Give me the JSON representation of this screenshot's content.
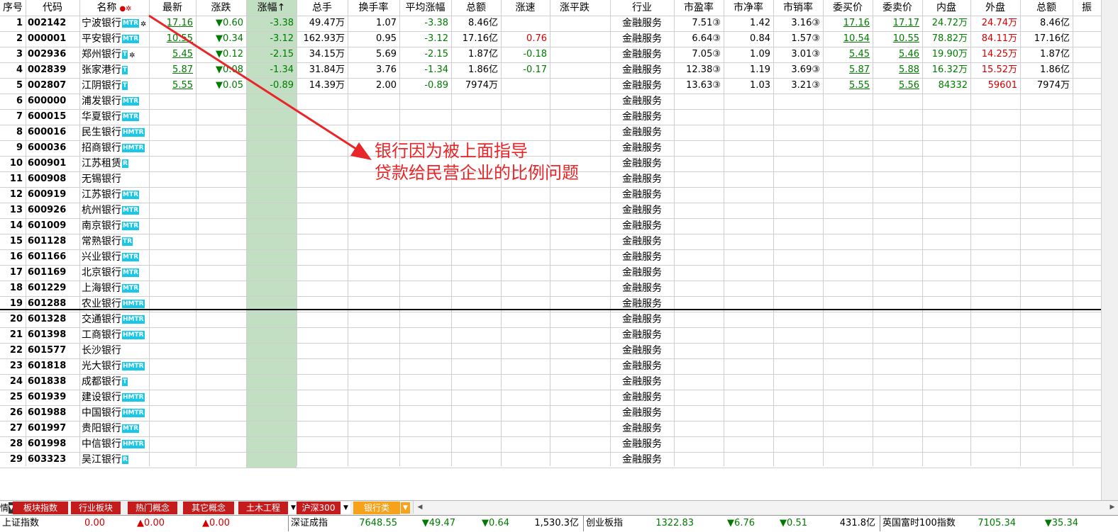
{
  "columns": [
    "序号",
    "代码",
    "名称",
    "最新",
    "涨跌",
    "涨幅↑",
    "总手",
    "换手率",
    "平均涨幅",
    "总额",
    "涨速",
    "涨平跌",
    "",
    "行业",
    "市盈率",
    "市净率",
    "市销率",
    "委买价",
    "委卖价",
    "内盘",
    "外盘",
    "总额",
    "振"
  ],
  "name_header_marks": "●✲",
  "rows": [
    {
      "no": "1",
      "code": "002142",
      "name": "宁波银行",
      "badge": "MTR",
      "mark": "✲",
      "last": "17.16",
      "chg": "▼0.60",
      "pct": "-3.38",
      "vol": "49.47万",
      "turn": "1.07",
      "avg": "-3.38",
      "amt": "8.46亿",
      "speed": "",
      "ind": "金融服务",
      "pe": "7.51③",
      "pb": "1.42",
      "ps": "3.16③",
      "bid": "17.16",
      "ask": "17.17",
      "inner": "24.72万",
      "outer": "24.74万",
      "amt2": "8.46亿"
    },
    {
      "no": "2",
      "code": "000001",
      "name": "平安银行",
      "badge": "MTR",
      "mark": "",
      "last": "10.55",
      "chg": "▼0.34",
      "pct": "-3.12",
      "vol": "162.93万",
      "turn": "0.95",
      "avg": "-3.12",
      "amt": "17.16亿",
      "speed": "0.76",
      "ind": "金融服务",
      "pe": "6.64③",
      "pb": "0.84",
      "ps": "1.57③",
      "bid": "10.54",
      "ask": "10.55",
      "inner": "78.82万",
      "outer": "84.11万",
      "amt2": "17.16亿"
    },
    {
      "no": "3",
      "code": "002936",
      "name": "郑州银行",
      "badge": "T",
      "mark": "✲",
      "last": "5.45",
      "chg": "▼0.12",
      "pct": "-2.15",
      "vol": "34.15万",
      "turn": "5.69",
      "avg": "-2.15",
      "amt": "1.87亿",
      "speed": "-0.18",
      "ind": "金融服务",
      "pe": "7.05③",
      "pb": "1.09",
      "ps": "3.01③",
      "bid": "5.45",
      "ask": "5.46",
      "inner": "19.90万",
      "outer": "14.25万",
      "amt2": "1.87亿"
    },
    {
      "no": "4",
      "code": "002839",
      "name": "张家港行",
      "badge": "T",
      "mark": "",
      "last": "5.87",
      "chg": "▼0.08",
      "pct": "-1.34",
      "vol": "31.84万",
      "turn": "3.76",
      "avg": "-1.34",
      "amt": "1.86亿",
      "speed": "-0.17",
      "ind": "金融服务",
      "pe": "12.38③",
      "pb": "1.19",
      "ps": "3.69③",
      "bid": "5.87",
      "ask": "5.88",
      "inner": "16.32万",
      "outer": "15.52万",
      "amt2": "1.86亿"
    },
    {
      "no": "5",
      "code": "002807",
      "name": "江阴银行",
      "badge": "T",
      "mark": "",
      "last": "5.55",
      "chg": "▼0.05",
      "pct": "-0.89",
      "vol": "14.39万",
      "turn": "2.00",
      "avg": "-0.89",
      "amt": "7974万",
      "speed": "",
      "ind": "金融服务",
      "pe": "13.63③",
      "pb": "1.03",
      "ps": "3.21③",
      "bid": "5.55",
      "ask": "5.56",
      "inner": "84332",
      "outer": "59601",
      "amt2": "7974万"
    },
    {
      "no": "6",
      "code": "600000",
      "name": "浦发银行",
      "badge": "MTR",
      "ind": "金融服务"
    },
    {
      "no": "7",
      "code": "600015",
      "name": "华夏银行",
      "badge": "MTR",
      "ind": "金融服务"
    },
    {
      "no": "8",
      "code": "600016",
      "name": "民生银行",
      "badge": "HMTR",
      "ind": "金融服务"
    },
    {
      "no": "9",
      "code": "600036",
      "name": "招商银行",
      "badge": "HMTR",
      "ind": "金融服务"
    },
    {
      "no": "10",
      "code": "600901",
      "name": "江苏租赁",
      "badge": "R",
      "ind": "金融服务"
    },
    {
      "no": "11",
      "code": "600908",
      "name": "无锡银行",
      "badge": "",
      "ind": "金融服务"
    },
    {
      "no": "12",
      "code": "600919",
      "name": "江苏银行",
      "badge": "MTR",
      "ind": "金融服务"
    },
    {
      "no": "13",
      "code": "600926",
      "name": "杭州银行",
      "badge": "MTR",
      "ind": "金融服务"
    },
    {
      "no": "14",
      "code": "601009",
      "name": "南京银行",
      "badge": "MTR",
      "ind": "金融服务"
    },
    {
      "no": "15",
      "code": "601128",
      "name": "常熟银行",
      "badge": "TR",
      "ind": "金融服务"
    },
    {
      "no": "16",
      "code": "601166",
      "name": "兴业银行",
      "badge": "MTR",
      "ind": "金融服务"
    },
    {
      "no": "17",
      "code": "601169",
      "name": "北京银行",
      "badge": "MTR",
      "ind": "金融服务"
    },
    {
      "no": "18",
      "code": "601229",
      "name": "上海银行",
      "badge": "MTR",
      "ind": "金融服务"
    },
    {
      "no": "19",
      "code": "601288",
      "name": "农业银行",
      "badge": "HMTR",
      "ind": "金融服务"
    },
    {
      "no": "20",
      "code": "601328",
      "name": "交通银行",
      "badge": "HMTR",
      "ind": "金融服务"
    },
    {
      "no": "21",
      "code": "601398",
      "name": "工商银行",
      "badge": "HMTR",
      "ind": "金融服务"
    },
    {
      "no": "22",
      "code": "601577",
      "name": "长沙银行",
      "badge": "",
      "ind": "金融服务"
    },
    {
      "no": "23",
      "code": "601818",
      "name": "光大银行",
      "badge": "HMTR",
      "ind": "金融服务"
    },
    {
      "no": "24",
      "code": "601838",
      "name": "成都银行",
      "badge": "T",
      "ind": "金融服务"
    },
    {
      "no": "25",
      "code": "601939",
      "name": "建设银行",
      "badge": "HMTR",
      "ind": "金融服务"
    },
    {
      "no": "26",
      "code": "601988",
      "name": "中国银行",
      "badge": "HMTR",
      "ind": "金融服务"
    },
    {
      "no": "27",
      "code": "601997",
      "name": "贵阳银行",
      "badge": "MTR",
      "ind": "金融服务"
    },
    {
      "no": "28",
      "code": "601998",
      "name": "中信银行",
      "badge": "HMTR",
      "ind": "金融服务"
    },
    {
      "no": "29",
      "code": "603323",
      "name": "吴江银行",
      "badge": "R",
      "ind": "金融服务"
    }
  ],
  "annotation": {
    "line1": "银行因为被上面指导",
    "line2": "贷款给民营企业的比例问题",
    "color": "#e8262a"
  },
  "tabs": [
    {
      "label": "情",
      "arrow": true
    },
    {
      "label": "板块指数"
    },
    {
      "label": "行业板块"
    },
    {
      "label": "热门概念"
    },
    {
      "label": "其它概念"
    },
    {
      "label": "土木工程",
      "arrow": true
    },
    {
      "label": "沪深300",
      "arrow": true
    },
    {
      "label": "银行类",
      "arrow": true,
      "active": true
    }
  ],
  "status": {
    "sh_label": "上证指数",
    "sh_val": "0.00",
    "sh_chg": "▲0.00",
    "sh_pct": "▲0.00",
    "sz_label": "深证成指",
    "sz_val": "7648.55",
    "sz_chg": "▼49.47",
    "sz_pct": "▼0.64",
    "sz_amt": "1,530.3亿",
    "cy_label": "创业板指",
    "cy_val": "1322.83",
    "cy_chg": "▼6.76",
    "cy_pct": "▼0.51",
    "cy_amt": "431.8亿",
    "ftse_label": "英国富时100指数",
    "ftse_val": "7105.34",
    "ftse_chg": "▼35.34"
  },
  "colors": {
    "sort_column_bg": "#c3dfc3",
    "tab_red": "#c41c1c",
    "tab_orange": "#f7a21b",
    "down_green": "#007a00",
    "up_red": "#d40000",
    "badge_cyan": "#19c7e8"
  }
}
